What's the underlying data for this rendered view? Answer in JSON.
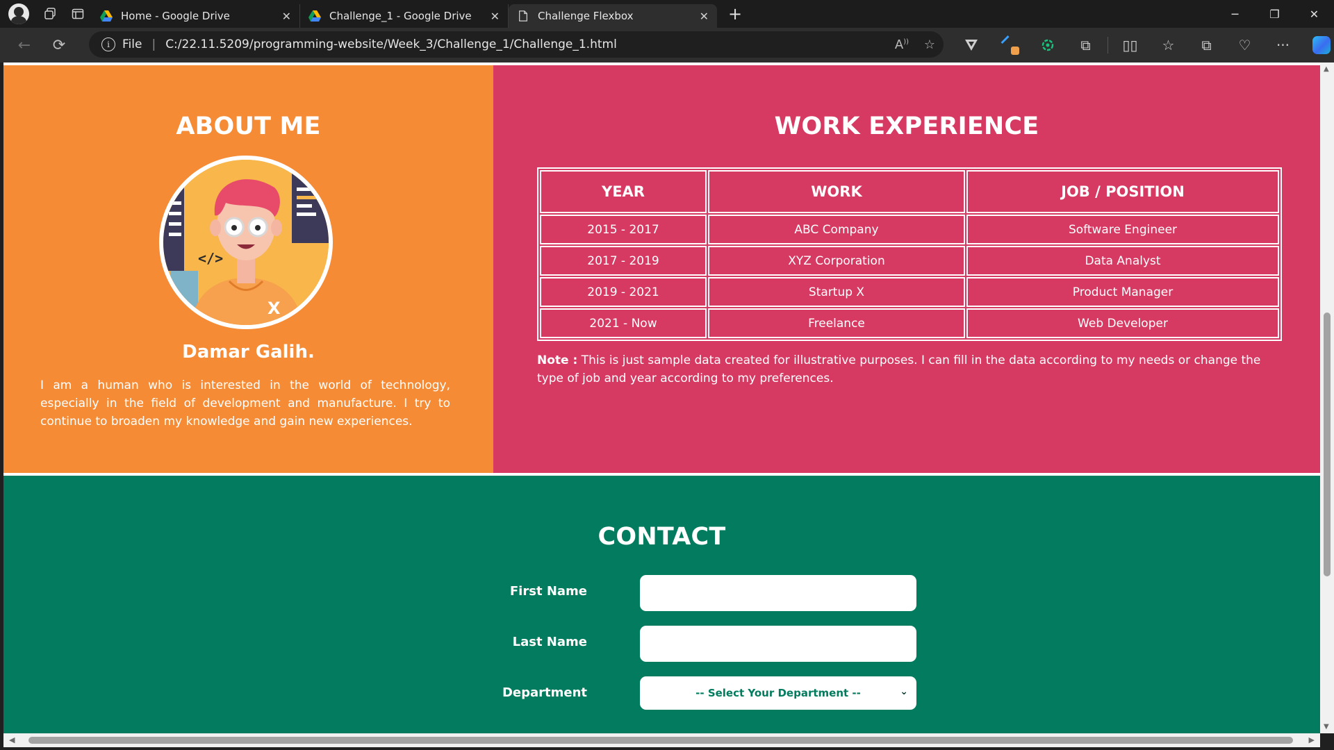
{
  "browser": {
    "tabs": [
      {
        "label": "Home - Google Drive",
        "favicon": "google-drive-icon"
      },
      {
        "label": "Challenge_1 - Google Drive",
        "favicon": "google-drive-icon"
      },
      {
        "label": "Challenge Flexbox",
        "favicon": "page-icon",
        "active": true
      }
    ],
    "address": {
      "scheme_label": "File",
      "url": "C:/22.11.5209/programming-website/Week_3/Challenge_1/Challenge_1.html"
    }
  },
  "about": {
    "title": "ABOUT ME",
    "name": "Damar Galih.",
    "bio": "I am a human who is interested in the world of technology, especially in the field of development and manufacture. I try to continue to broaden my knowledge and gain new experiences.",
    "avatar_code_glyph": "</>",
    "avatar_x_glyph": "X",
    "color": "#f68b35"
  },
  "work": {
    "title": "WORK EXPERIENCE",
    "headers": [
      "YEAR",
      "WORK",
      "JOB / POSITION"
    ],
    "rows": [
      [
        "2015 - 2017",
        "ABC Company",
        "Software Engineer"
      ],
      [
        "2017 - 2019",
        "XYZ Corporation",
        "Data Analyst"
      ],
      [
        "2019 - 2021",
        "Startup X",
        "Product Manager"
      ],
      [
        "2021 - Now",
        "Freelance",
        "Web Developer"
      ]
    ],
    "note_label": "Note :",
    "note_text": " This is just sample data created for illustrative purposes. I can fill in the data according to my needs or change the type of job and year according to my preferences.",
    "color": "#d63a62"
  },
  "contact": {
    "title": "CONTACT",
    "first_name_label": "First Name",
    "first_name_value": "",
    "last_name_label": "Last Name",
    "last_name_value": "",
    "department_label": "Department",
    "department_selected": "-- Select Your Department --",
    "color": "#037b5e"
  }
}
